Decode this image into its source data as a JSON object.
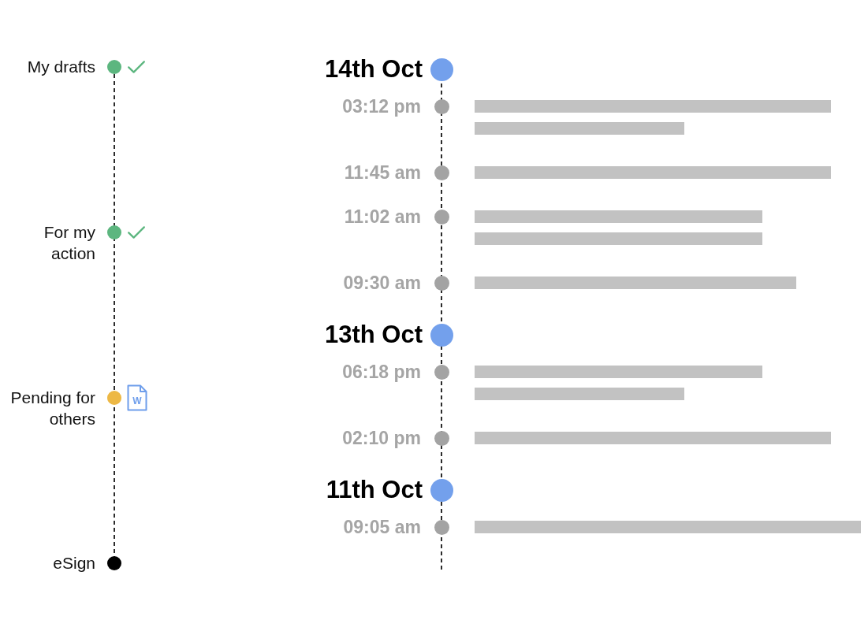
{
  "stepper": {
    "steps": [
      {
        "label": "My drafts",
        "color": "#5cb67f",
        "kind": "done"
      },
      {
        "label": "For my action",
        "color": "#5cb67f",
        "kind": "done"
      },
      {
        "label": "Pending for others",
        "color": "#edb845",
        "kind": "file",
        "file_badge": "W"
      },
      {
        "label": "eSign",
        "color": "#000000",
        "kind": "end"
      }
    ]
  },
  "timeline": {
    "days": [
      {
        "date": "14th Oct",
        "entries": [
          {
            "time": "03:12 pm",
            "lines": [
              {
                "kind": "long"
              },
              {
                "kind": "short"
              }
            ]
          },
          {
            "time": "11:45 am",
            "lines": [
              {
                "kind": "long"
              }
            ]
          },
          {
            "time": "11:02 am",
            "lines": [
              {
                "kind": "medium"
              },
              {
                "kind": "medium"
              }
            ]
          },
          {
            "time": "09:30 am",
            "lines": [
              {
                "kind": "wide"
              }
            ]
          }
        ]
      },
      {
        "date": "13th Oct",
        "entries": [
          {
            "time": "06:18 pm",
            "lines": [
              {
                "kind": "medium"
              },
              {
                "kind": "short"
              }
            ]
          },
          {
            "time": "02:10 pm",
            "lines": [
              {
                "kind": "long"
              }
            ]
          }
        ]
      },
      {
        "date": "11th Oct",
        "entries": [
          {
            "time": "09:05 am",
            "lines": [
              {
                "kind": "full"
              }
            ]
          }
        ]
      }
    ]
  }
}
